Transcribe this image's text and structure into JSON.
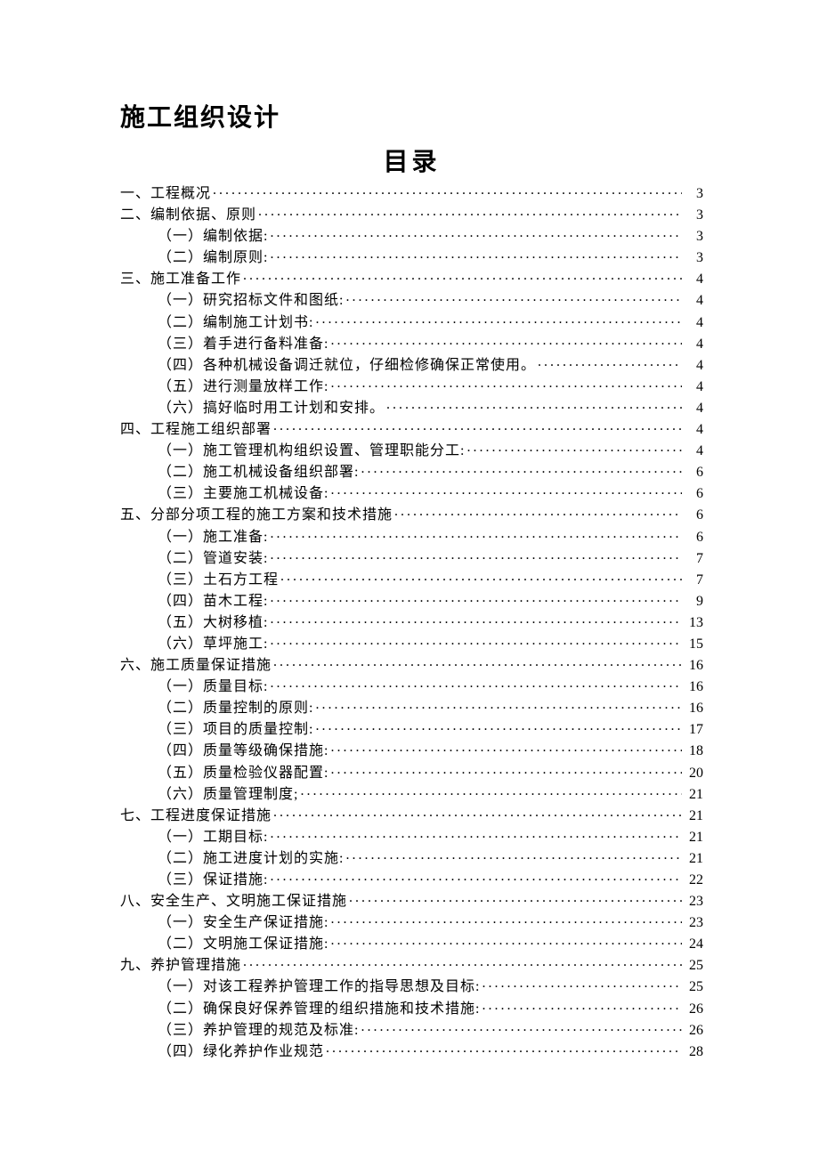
{
  "doc_title": "施工组织设计",
  "toc_title": "目录",
  "toc": [
    {
      "level": 1,
      "num": "一、",
      "label": "工程概况",
      "page": "3"
    },
    {
      "level": 1,
      "num": "二、",
      "label": "编制依据、原则",
      "page": "3"
    },
    {
      "level": 2,
      "num": "（一）",
      "label": "编制依据:",
      "page": "3"
    },
    {
      "level": 2,
      "num": "（二）",
      "label": "编制原则:",
      "page": "3"
    },
    {
      "level": 1,
      "num": "三、",
      "label": "施工准备工作",
      "page": "4"
    },
    {
      "level": 2,
      "num": "（一）",
      "label": "研究招标文件和图纸:",
      "page": "4"
    },
    {
      "level": 2,
      "num": "（二）",
      "label": "编制施工计划书:",
      "page": "4"
    },
    {
      "level": 2,
      "num": "（三）",
      "label": "着手进行备料准备:",
      "page": "4"
    },
    {
      "level": 2,
      "num": "（四）",
      "label": "各种机械设备调迁就位，仔细检修确保正常使用。",
      "page": "4"
    },
    {
      "level": 2,
      "num": "（五）",
      "label": "进行测量放样工作:",
      "page": "4"
    },
    {
      "level": 2,
      "num": "（六）",
      "label": "搞好临时用工计划和安排。",
      "page": "4"
    },
    {
      "level": 1,
      "num": "四、",
      "label": "工程施工组织部署",
      "page": "4"
    },
    {
      "level": 2,
      "num": "（一）",
      "label": "施工管理机构组织设置、管理职能分工:",
      "page": "4"
    },
    {
      "level": 2,
      "num": "（二）",
      "label": "施工机械设备组织部署:",
      "page": "6"
    },
    {
      "level": 2,
      "num": "（三）",
      "label": "主要施工机械设备:",
      "page": "6"
    },
    {
      "level": 1,
      "num": "五、",
      "label": "分部分项工程的施工方案和技术措施",
      "page": "6"
    },
    {
      "level": 2,
      "num": "（一）",
      "label": "施工准备:",
      "page": "6"
    },
    {
      "level": 2,
      "num": "（二）",
      "label": "管道安装:",
      "page": "7"
    },
    {
      "level": 2,
      "num": "（三）",
      "label": "土石方工程",
      "page": "7"
    },
    {
      "level": 2,
      "num": "（四）",
      "label": "苗木工程:",
      "page": "9"
    },
    {
      "level": 2,
      "num": "（五）",
      "label": "大树移植:",
      "page": "13"
    },
    {
      "level": 2,
      "num": "（六）",
      "label": "草坪施工:",
      "page": "15"
    },
    {
      "level": 1,
      "num": "六、",
      "label": "施工质量保证措施",
      "page": "16"
    },
    {
      "level": 2,
      "num": "（一）",
      "label": "质量目标:",
      "page": "16"
    },
    {
      "level": 2,
      "num": "（二）",
      "label": "质量控制的原则:",
      "page": "16"
    },
    {
      "level": 2,
      "num": "（三）",
      "label": "项目的质量控制:",
      "page": "17"
    },
    {
      "level": 2,
      "num": "（四）",
      "label": "质量等级确保措施:",
      "page": "18"
    },
    {
      "level": 2,
      "num": "（五）",
      "label": "质量检验仪器配置:",
      "page": "20"
    },
    {
      "level": 2,
      "num": "（六）",
      "label": "质量管理制度;",
      "page": "21"
    },
    {
      "level": 1,
      "num": "七、",
      "label": "工程进度保证措施",
      "page": "21"
    },
    {
      "level": 2,
      "num": "（一）",
      "label": "工期目标:",
      "page": "21"
    },
    {
      "level": 2,
      "num": "（二）",
      "label": "施工进度计划的实施:",
      "page": "21"
    },
    {
      "level": 2,
      "num": "（三）",
      "label": "保证措施:",
      "page": "22"
    },
    {
      "level": 1,
      "num": "八、",
      "label": "安全生产、文明施工保证措施",
      "page": "23"
    },
    {
      "level": 2,
      "num": "（一）",
      "label": "安全生产保证措施:",
      "page": "23"
    },
    {
      "level": 2,
      "num": "（二）",
      "label": "文明施工保证措施:",
      "page": "24"
    },
    {
      "level": 1,
      "num": "九、",
      "label": "养护管理措施",
      "page": "25"
    },
    {
      "level": 2,
      "num": "（一）",
      "label": "对该工程养护管理工作的指导思想及目标:",
      "page": "25"
    },
    {
      "level": 2,
      "num": "（二）",
      "label": "确保良好保养管理的组织措施和技术措施:",
      "page": "26"
    },
    {
      "level": 2,
      "num": "（三）",
      "label": "养护管理的规范及标准:",
      "page": "26"
    },
    {
      "level": 2,
      "num": "（四）",
      "label": "绿化养护作业规范",
      "page": "28"
    }
  ]
}
